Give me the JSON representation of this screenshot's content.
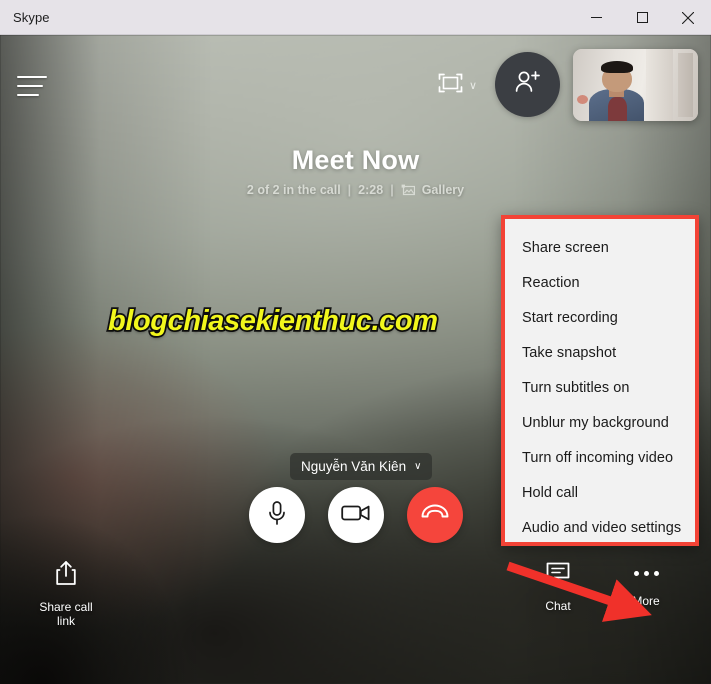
{
  "window": {
    "title": "Skype",
    "controls": [
      {
        "name": "minimize-button",
        "glyph": "minimize"
      },
      {
        "name": "maximize-button",
        "glyph": "maximize"
      },
      {
        "name": "close-button",
        "glyph": "close"
      }
    ]
  },
  "toolbar": {
    "menu_icon": "hamburger-menu-icon",
    "layout_icon": "layout-frame-icon",
    "layout_chevron": "∨",
    "add_person_icon": "add-person-icon",
    "self_view": "self-view-thumbnail"
  },
  "call": {
    "title": "Meet Now",
    "participants": "2 of 2 in the call",
    "divider": "|",
    "duration": "2:28",
    "divider2": "|",
    "view_icon": "gallery-icon",
    "view_label": "Gallery"
  },
  "watermark": {
    "text": "blogchiasekienthuc.com",
    "color": "#f2f71c"
  },
  "participant": {
    "name": "Nguyễn Văn Kiên",
    "chevron": "∨"
  },
  "controls": {
    "mic": {
      "label": "Microphone",
      "icon": "microphone-icon"
    },
    "camera": {
      "label": "Camera",
      "icon": "video-camera-icon"
    },
    "hangup": {
      "label": "End call",
      "icon": "end-call-icon",
      "color": "#f5453c"
    }
  },
  "bottom_bar": {
    "share": {
      "label_line1": "Share call",
      "label_line2": "link",
      "icon": "share-icon"
    },
    "chat": {
      "label": "Chat",
      "icon": "chat-bubble-icon"
    },
    "more": {
      "label": "More",
      "icon": "more-dots-icon"
    }
  },
  "more_menu": {
    "border_color": "#f34336",
    "items": [
      {
        "label": "Share screen"
      },
      {
        "label": "Reaction"
      },
      {
        "label": "Start recording"
      },
      {
        "label": "Take snapshot"
      },
      {
        "label": "Turn subtitles on"
      },
      {
        "label": "Unblur my background"
      },
      {
        "label": "Turn off incoming video"
      },
      {
        "label": "Hold call"
      },
      {
        "label": "Audio and video settings"
      }
    ]
  },
  "annotation": {
    "arrow_color": "#f0312a",
    "points_to": "More"
  }
}
